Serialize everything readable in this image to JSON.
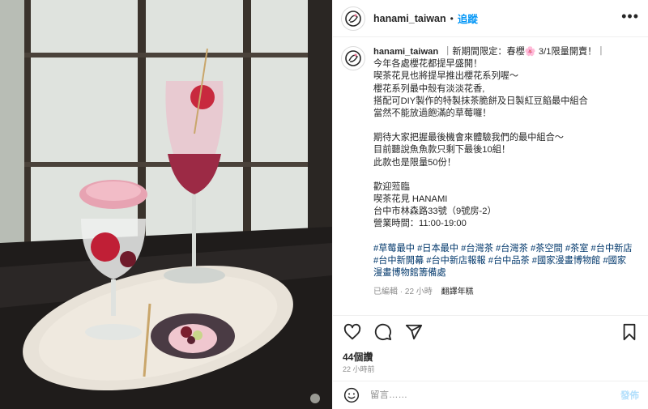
{
  "post": {
    "username": "hanami_taiwan",
    "follow_label": "追蹤",
    "more_label": "•••"
  },
  "caption": {
    "username": "hanami_taiwan",
    "lines": [
      "｜新期間限定：春櫻🌸 3/1限量開賣！｜",
      "今年各處櫻花都提早盛開！",
      "喫茶花見也將提早推出櫻花系列喔～",
      "櫻花系列最中殼有淡淡花香,",
      "搭配可DIY製作的特製抹茶脆餅及日製紅豆餡最中組合",
      "當然不能放過飽滿的草莓囉！",
      "",
      "期待大家把握最後機會來體驗我們的最中組合～",
      "目前聽說魚魚款只剩下最後10組！",
      "此款也是限量50份！",
      "",
      "歡迎蒞臨",
      "喫茶花見 HANAMI",
      "台中市林森路33號（9號房-2）",
      "營業時間：11:00-19:00",
      ""
    ],
    "tags": [
      "#草莓最中 #日本最中 #台灣茶 #台灣茶 #茶空間 #茶室 #台中新店",
      "#台中新開幕 #台中新店報報 #台中品茶 #國家漫畫博物館 #國家",
      "漫畫博物館籌備處"
    ],
    "edited": "已編輯 · 22 小時",
    "translate": "翻譯年糕"
  },
  "engagement": {
    "likes": "44個讚",
    "time": "22 小時前"
  },
  "comment": {
    "placeholder": "留言……",
    "post_label": "發佈"
  }
}
